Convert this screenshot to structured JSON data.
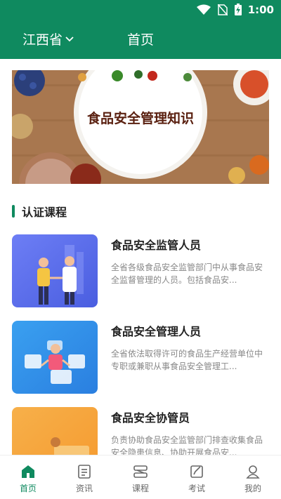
{
  "status": {
    "time": "1:00"
  },
  "header": {
    "province": "江西省",
    "title": "首页"
  },
  "banner": {
    "title": "食品安全管理知识"
  },
  "section": {
    "title": "认证课程"
  },
  "courses": [
    {
      "title": "食品安全监管人员",
      "desc": "全省各级食品安全监管部门中从事食品安全监督管理的人员。包括食品安..."
    },
    {
      "title": "食品安全管理人员",
      "desc": "全省依法取得许可的食品生产经营单位中专职或兼职从事食品安全管理工..."
    },
    {
      "title": "食品安全协管员",
      "desc": "负责协助食品安全监管部门排查收集食品安全隐患信息、协助开展食品安..."
    }
  ],
  "nav": [
    {
      "label": "首页",
      "icon": "home-icon",
      "active": true
    },
    {
      "label": "资讯",
      "icon": "news-icon",
      "active": false
    },
    {
      "label": "课程",
      "icon": "course-icon",
      "active": false
    },
    {
      "label": "考试",
      "icon": "exam-icon",
      "active": false
    },
    {
      "label": "我的",
      "icon": "profile-icon",
      "active": false
    }
  ],
  "colors": {
    "brand": "#0f8a5f"
  }
}
